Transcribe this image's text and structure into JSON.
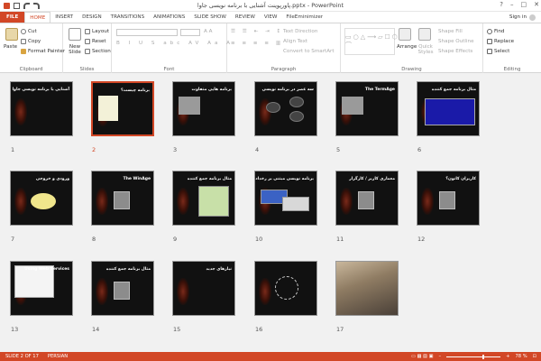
{
  "window": {
    "title": "پاورپوینت آشنایی با برنامه نویسی جاوا.pptx - PowerPoint",
    "controls": [
      "?",
      "–",
      "□",
      "✕"
    ]
  },
  "tabs": [
    "FILE",
    "HOME",
    "INSERT",
    "DESIGN",
    "TRANSITIONS",
    "ANIMATIONS",
    "SLIDE SHOW",
    "REVIEW",
    "VIEW",
    "FileEminimizer"
  ],
  "signin": "Sign in",
  "ribbon": {
    "clipboard": {
      "paste": "Paste",
      "cut": "Cut",
      "copy": "Copy",
      "format_painter": "Format Painter",
      "label": "Clipboard"
    },
    "slides": {
      "new_slide": "New Slide",
      "layout": "Layout",
      "reset": "Reset",
      "section": "Section",
      "label": "Slides"
    },
    "font": {
      "label": "Font"
    },
    "paragraph": {
      "text_direction": "Text Direction",
      "align_text": "Align Text",
      "convert": "Convert to SmartArt",
      "label": "Paragraph"
    },
    "drawing": {
      "arrange": "Arrange",
      "quick_styles": "Quick Styles",
      "shape_fill": "Shape Fill",
      "shape_outline": "Shape Outline",
      "shape_effects": "Shape Effects",
      "label": "Drawing"
    },
    "editing": {
      "find": "Find",
      "replace": "Replace",
      "select": "Select",
      "label": "Editing"
    }
  },
  "slides": [
    {
      "n": "1",
      "title": "آشنایی با برنامه نویسی جاوا",
      "type": "cover"
    },
    {
      "n": "2",
      "title": "برنامه چیست؟",
      "type": "bullets-light",
      "selected": true
    },
    {
      "n": "3",
      "title": "برنامه هایی متفاوت",
      "type": "boxes"
    },
    {
      "n": "4",
      "title": "سه عصر در برنامه نویسی",
      "type": "circles"
    },
    {
      "n": "5",
      "title": "The TermAge",
      "type": "photo-text"
    },
    {
      "n": "6",
      "title": "مثال برنامه جمع کننده",
      "type": "code"
    },
    {
      "n": "7",
      "title": "ورودی و خروجی",
      "type": "flow"
    },
    {
      "n": "8",
      "title": "The WinAge",
      "type": "computer"
    },
    {
      "n": "9",
      "title": "مثال برنامه جمع کننده",
      "type": "dialog"
    },
    {
      "n": "10",
      "title": "برنامه نویسی مبتنی بر رخداد",
      "type": "windows"
    },
    {
      "n": "11",
      "title": "معماری کاربر / کارگزار",
      "type": "server"
    },
    {
      "n": "12",
      "title": "کاربران کانون؟",
      "type": "server2"
    },
    {
      "n": "13",
      "title": "Using Web Services",
      "type": "web"
    },
    {
      "n": "14",
      "title": "مثال برنامه جمع کننده",
      "type": "laptop"
    },
    {
      "n": "15",
      "title": "نیازهای جدید",
      "type": "bullets"
    },
    {
      "n": "16",
      "title": "",
      "type": "network"
    },
    {
      "n": "17",
      "title": "",
      "type": "photo"
    }
  ],
  "status": {
    "slide": "SLIDE 2 OF 17",
    "lang": "PERSIAN",
    "zoom": "78 %"
  },
  "colors": {
    "accent": "#d24726",
    "slide_bg": "#111111"
  }
}
